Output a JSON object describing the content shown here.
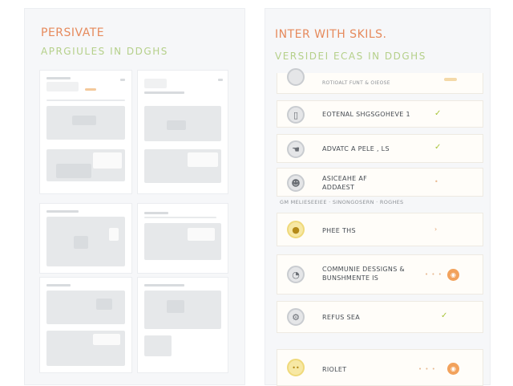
{
  "left_panel": {
    "title": "PERSIVATE",
    "subtitle": "APRGIULES IN DDGHS",
    "title_color": "#e68a5c",
    "subtitle_color": "#b5d08a"
  },
  "right_panel": {
    "title": "INTER WITH SKILS.",
    "subtitle": "VERSIDEI ECAS IN DDGHS",
    "title_color": "#e68a5c",
    "subtitle_color": "#b5d08a",
    "top_item_label": "ROTIOALT FUNT & OIEOSE",
    "items": [
      {
        "label": "EOTENAL SHGSGOHEVE 1",
        "icon": "phone-icon",
        "icon_glyph": "▯",
        "marker": "✓"
      },
      {
        "label": "ADVATC A PELE , LS",
        "icon": "hand-icon",
        "icon_glyph": "☚",
        "marker": "✓"
      },
      {
        "label": "ASICEAHE AF\nADDAEST",
        "icon": "robot-icon",
        "icon_glyph": "☻",
        "marker": "•"
      }
    ],
    "section_label": "GM MELIESEEIEE · SINONGOSERN · ROGHES",
    "items2": [
      {
        "label": "PHEE THS",
        "icon": "bulb-icon",
        "icon_glyph": "●",
        "marker": "›"
      },
      {
        "label": "COMMUNIE DESSIGNS &\nBUNSHMENTE IS",
        "icon": "chat-icon",
        "icon_glyph": "◔",
        "dots": "• • •",
        "orb": "◉"
      },
      {
        "label": "REFUS SEA",
        "icon": "gear-icon",
        "icon_glyph": "⚙",
        "marker": "✓"
      },
      {
        "label": "RIOLET",
        "icon": "face-icon",
        "icon_glyph": "••",
        "dots": "• • •",
        "orb": "◉"
      }
    ]
  }
}
